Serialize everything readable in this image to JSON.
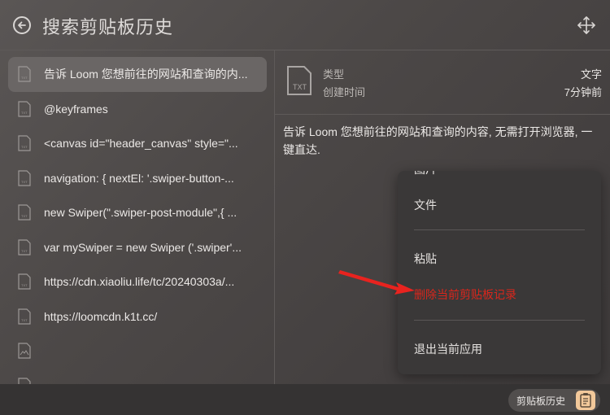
{
  "header": {
    "back_icon": "back-arrow-icon",
    "title": "搜索剪贴板历史",
    "move_icon": "move-arrows-icon"
  },
  "list": {
    "items": [
      {
        "label": "告诉 Loom 您想前往的网站和查询的内...",
        "icon": "text-file-icon",
        "active": true
      },
      {
        "label": "@keyframes",
        "icon": "text-file-icon"
      },
      {
        "label": "<canvas id=\"header_canvas\" style=\"...",
        "icon": "text-file-icon"
      },
      {
        "label": "navigation: { nextEl: '.swiper-button-...",
        "icon": "text-file-icon"
      },
      {
        "label": "new Swiper(\".swiper-post-module\",{ ...",
        "icon": "text-file-icon"
      },
      {
        "label": "var mySwiper = new Swiper ('.swiper'...",
        "icon": "text-file-icon"
      },
      {
        "label": "https://cdn.xiaoliu.life/tc/20240303a/...",
        "icon": "text-file-icon"
      },
      {
        "label": "https://loomcdn.k1t.cc/",
        "icon": "text-file-icon"
      },
      {
        "label": "",
        "icon": "image-file-icon"
      },
      {
        "label": "",
        "icon": "text-file-icon"
      }
    ]
  },
  "detail": {
    "file_icon": "txt-file-icon",
    "file_icon_label": "TXT",
    "type_label": "类型",
    "type_value": "文字",
    "created_label": "创建时间",
    "created_value": "7分钟前",
    "content": "告诉 Loom 您想前往的网站和查询的内容, 无需打开浏览器, 一键直达."
  },
  "context_menu": {
    "items": [
      {
        "label": "图片"
      },
      {
        "label": "文件"
      },
      {
        "label": "粘贴"
      },
      {
        "label": "删除当前剪贴板记录",
        "danger": true
      },
      {
        "label": "退出当前应用"
      }
    ]
  },
  "footer": {
    "clipboard_button_label": "剪贴板历史",
    "clipboard_icon": "clipboard-icon"
  },
  "colors": {
    "accent_danger": "#d9261c",
    "arrow": "#e8231f",
    "clipboard_icon_bg": "#f2c89a"
  }
}
